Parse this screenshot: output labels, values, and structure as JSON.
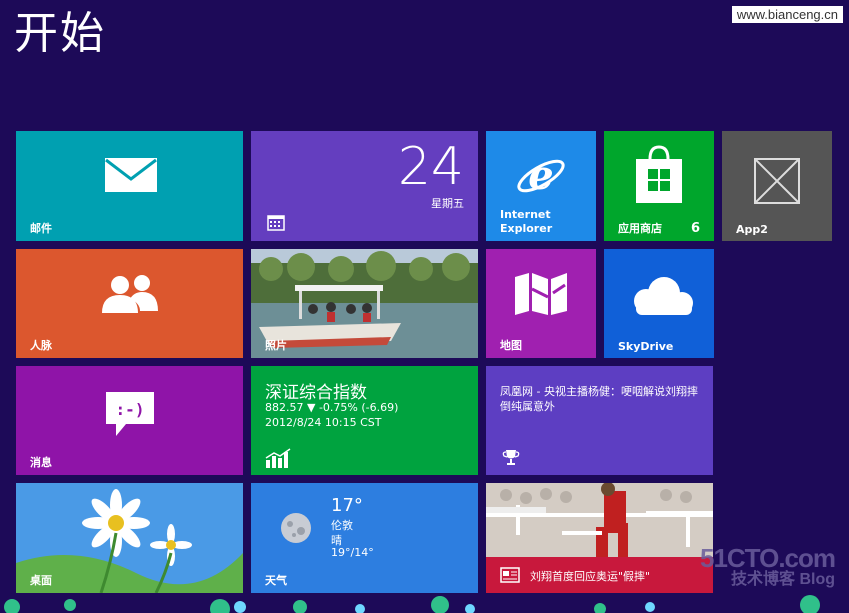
{
  "start": {
    "title": "开始"
  },
  "watermark": {
    "text": "www.bianceng.cn"
  },
  "tiles": {
    "mail": {
      "label": "邮件",
      "color": "#00a0b1"
    },
    "calendar": {
      "day": "24",
      "weekday": "星期五",
      "color": "#643ebf"
    },
    "ie": {
      "label": "Internet Explorer",
      "color": "#1e8ae8"
    },
    "store": {
      "label": "应用商店",
      "badge": "6",
      "color": "#00a62c"
    },
    "app2": {
      "label": "App2",
      "color": "#555555"
    },
    "people": {
      "label": "人脉",
      "color": "#dc572e"
    },
    "photos": {
      "label": "照片"
    },
    "maps": {
      "label": "地图",
      "color": "#a020b0"
    },
    "skydrive": {
      "label": "SkyDrive",
      "color": "#1060d8"
    },
    "messaging": {
      "label": "消息",
      "color": "#8f14a8"
    },
    "finance": {
      "title": "深证综合指数",
      "quote": "882.57 ▼ -0.75% (-6.69)",
      "time": "2012/8/24 10:15 CST",
      "color": "#00a33f"
    },
    "sports": {
      "headline": "凤凰网 - 央视主播杨健：哽咽解说刘翔摔倒纯属意外",
      "color": "#5d3ec2"
    },
    "desktop": {
      "label": "桌面"
    },
    "weather": {
      "label": "天气",
      "temp": "17°",
      "city": "伦敦",
      "condition": "晴",
      "range": "19°/14°",
      "color": "#2d7ee0"
    },
    "news": {
      "headline": "刘翔首度回应奥运\"假摔\"",
      "banner_color": "#c8183c"
    }
  },
  "logo": {
    "big": "51CTO.com",
    "small": "技术博客 Blog"
  }
}
